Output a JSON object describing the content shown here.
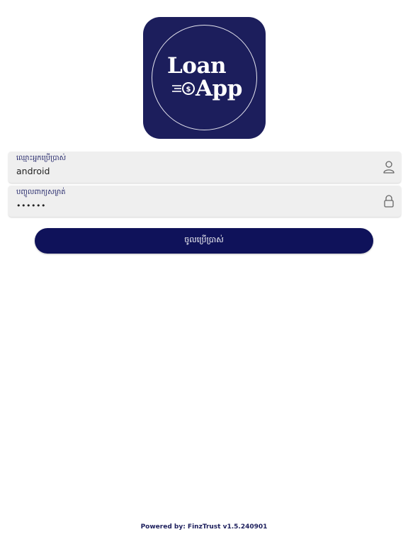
{
  "logo": {
    "line1": "Loan",
    "line2": "App",
    "background_color": "#1c1e5c",
    "icon": "coin-icon"
  },
  "username": {
    "label": "ឈ្មោះអ្នកប្រើប្រាស់",
    "value": "android",
    "icon": "user-icon"
  },
  "password": {
    "label": "បញ្ចូលពាក្យសម្ងាត់",
    "value": "••••••",
    "icon": "lock-icon"
  },
  "login_button": {
    "label": "ចូលប្រើប្រាស់",
    "color": "#0f125a"
  },
  "footer": {
    "text": "Powered by: FinzTrust v1.5.240901"
  }
}
